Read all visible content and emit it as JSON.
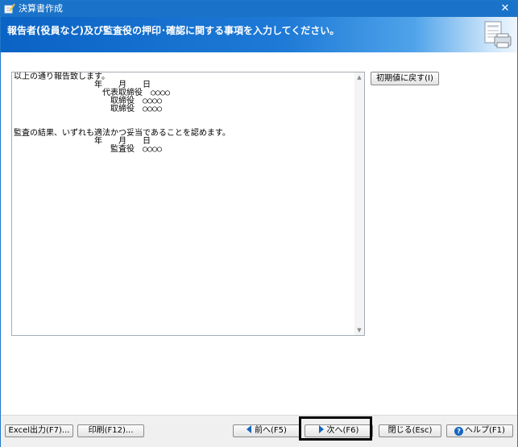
{
  "window": {
    "title": "決算書作成",
    "close_glyph": "✕"
  },
  "header": {
    "instruction": "報告者(役員など)及び監査役の押印･確認に関する事項を入力してください。"
  },
  "content": {
    "text": "以上の通り報告致します。\n　　　　　　　　　　年　　月　　日\n　　　　　　　　　　　代表取締役　○○○○\n　　　　　　　　　　　　取締役　○○○○\n　　　　　　　　　　　　取締役　○○○○\n\n\n監査の結果、いずれも適法かつ妥当であることを認めます。\n　　　　　　　　　　年　　月　　日\n　　　　　　　　　　　　監査役　○○○○"
  },
  "buttons": {
    "reset_label": "初期値に戻す(I)",
    "excel_label": "Excel出力(F7)...",
    "print_label": "印刷(F12)...",
    "prev_label": "前へ(F5)",
    "next_label": "次へ(F6)",
    "close_label": "閉じる(Esc)",
    "help_label": "ヘルプ(F1)",
    "help_glyph": "?"
  },
  "colors": {
    "titlebar": "#1a73c8",
    "header_gradient_start": "#0a63c5",
    "accent_blue": "#1565c0",
    "highlight_border": "#000000"
  },
  "icons": {
    "app": "notebook-pen-icon",
    "header": "printer-document-icon",
    "prev": "triangle-left-icon",
    "next": "triangle-right-icon",
    "help": "help-circle-icon"
  }
}
